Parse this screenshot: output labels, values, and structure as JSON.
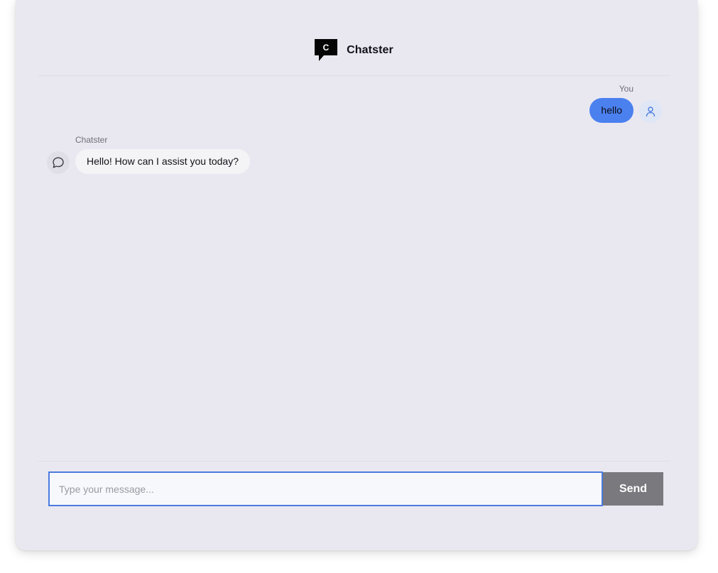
{
  "app": {
    "title": "Chatster",
    "logo_letter": "C"
  },
  "messages": [
    {
      "role": "user",
      "sender": "You",
      "text": "hello"
    },
    {
      "role": "assistant",
      "sender": "Chatster",
      "text": "Hello! How can I assist you today?"
    }
  ],
  "composer": {
    "placeholder": "Type your message...",
    "value": "",
    "send_label": "Send"
  },
  "icons": {
    "logo": "chat-logo-icon",
    "user_avatar": "user-icon",
    "bot_avatar": "chat-bubble-icon"
  },
  "colors": {
    "background": "#e9e8f1",
    "user_bubble": "#4b80ef",
    "bot_bubble": "#f4f4f7",
    "input_border": "#4b7be0",
    "send_button": "#7a797e"
  }
}
